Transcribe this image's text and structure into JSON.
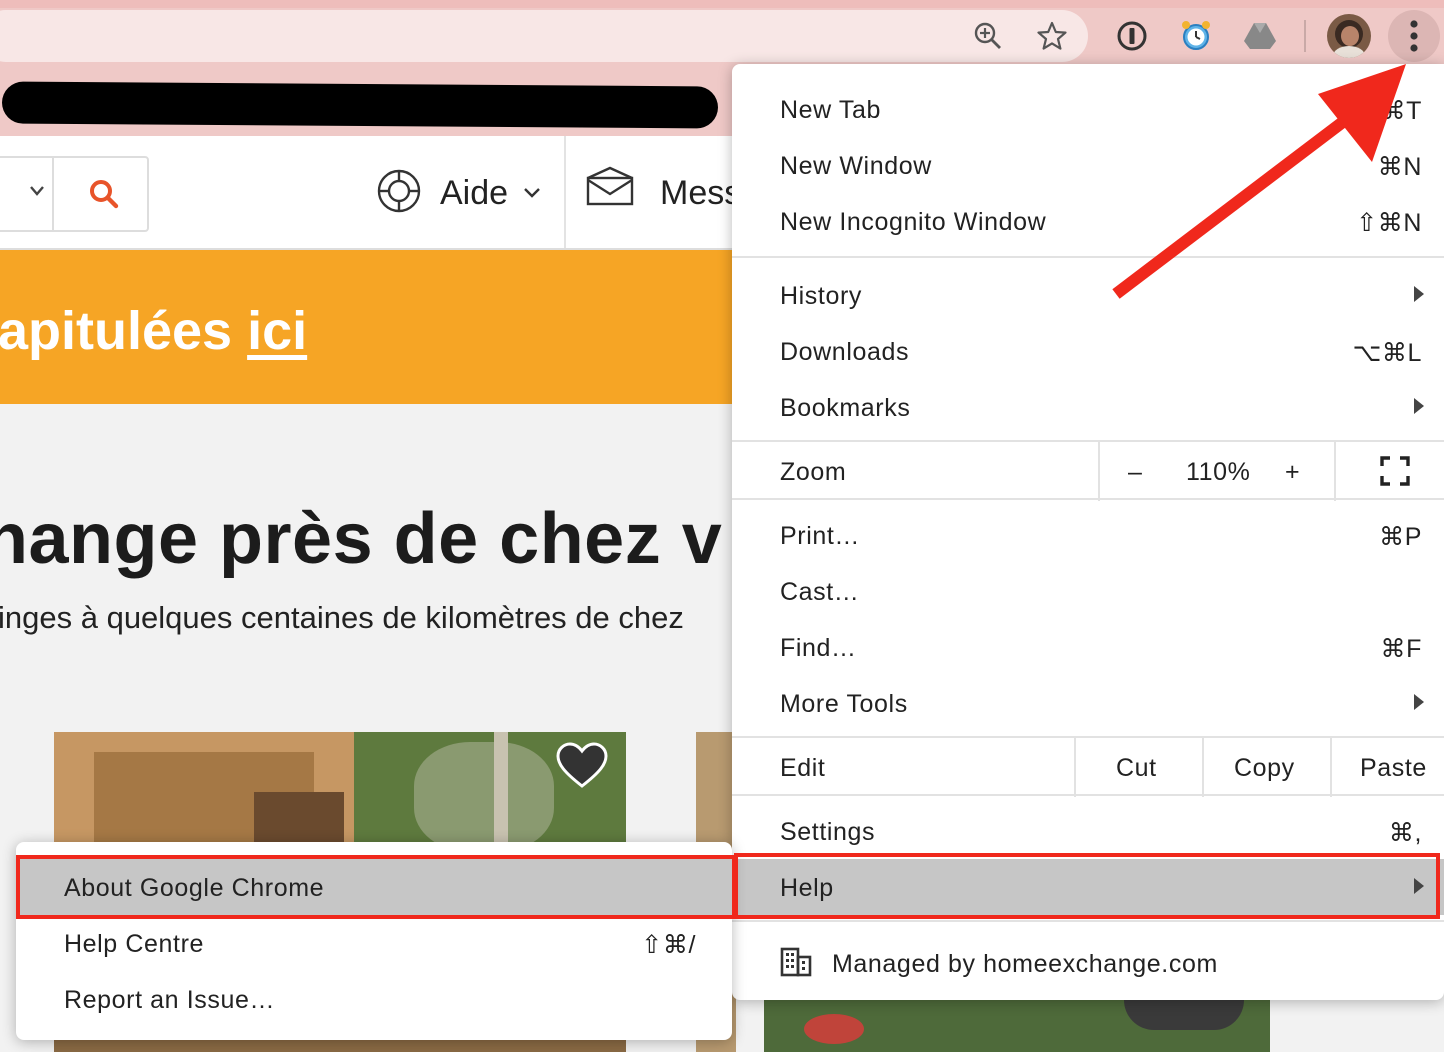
{
  "page": {
    "aide": "Aide",
    "messages": "Mess",
    "banner_text": "apitulées ",
    "banner_link": "ici",
    "heading": "hange près de chez v",
    "subheading": "inges à quelques centaines de kilomètres de chez"
  },
  "chrome_menu": {
    "new_tab": {
      "label": "New Tab",
      "shortcut": "⌘T"
    },
    "new_window": {
      "label": "New Window",
      "shortcut": "⌘N"
    },
    "incognito": {
      "label": "New Incognito Window",
      "shortcut": "⇧⌘N"
    },
    "history": {
      "label": "History"
    },
    "downloads": {
      "label": "Downloads",
      "shortcut": "⌥⌘L"
    },
    "bookmarks": {
      "label": "Bookmarks"
    },
    "zoom": {
      "label": "Zoom",
      "minus": "–",
      "level": "110%",
      "plus": "+"
    },
    "print": {
      "label": "Print…",
      "shortcut": "⌘P"
    },
    "cast": {
      "label": "Cast…"
    },
    "find": {
      "label": "Find…",
      "shortcut": "⌘F"
    },
    "more_tools": {
      "label": "More Tools"
    },
    "edit": {
      "label": "Edit",
      "cut": "Cut",
      "copy": "Copy",
      "paste": "Paste"
    },
    "settings": {
      "label": "Settings",
      "shortcut": "⌘,"
    },
    "help": {
      "label": "Help"
    },
    "managed": {
      "label": "Managed by homeexchange.com"
    }
  },
  "help_submenu": {
    "about": {
      "label": "About Google Chrome"
    },
    "help_centre": {
      "label": "Help Centre",
      "shortcut": "⇧⌘/"
    },
    "report": {
      "label": "Report an Issue…"
    }
  },
  "colors": {
    "accent": "#f6a525",
    "annotation": "#f0281c",
    "search_icon": "#e8542a"
  }
}
